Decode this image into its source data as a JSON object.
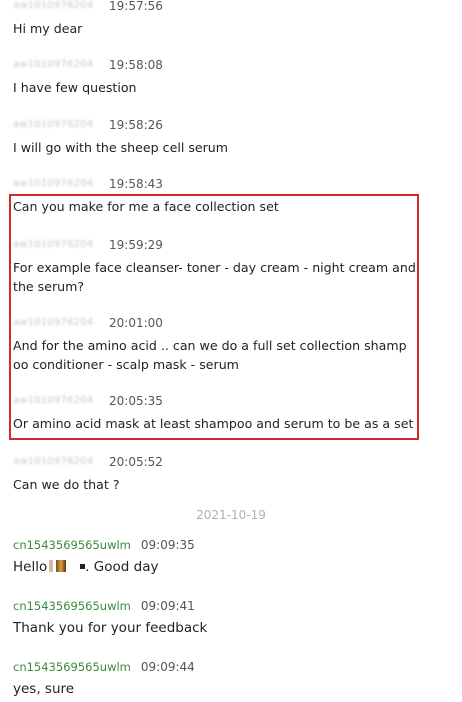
{
  "messages": [
    {
      "sender": "aw1010976204",
      "time": "19:57:56",
      "text": "Hi my dear"
    },
    {
      "sender": "aw1010976204",
      "time": "19:58:08",
      "text": "I have few question"
    },
    {
      "sender": "aw1010976204",
      "time": "19:58:26",
      "text": "I will go with the sheep cell serum"
    },
    {
      "sender": "aw1010976204",
      "time": "19:58:43",
      "text": "Can you make for me a face collection set"
    },
    {
      "sender": "aw1010976204",
      "time": "19:59:29",
      "text": "For example face cleanser- toner - day cream - night cream and the serum?"
    },
    {
      "sender": "aw1010976204",
      "time": "20:01:00",
      "text": "And for the amino acid .. can we do a full set collection shampoo conditioner - scalp mask - serum"
    },
    {
      "sender": "aw1010976204",
      "time": "20:05:35",
      "text": "Or amino acid mask at least shampoo and serum to be as a set"
    },
    {
      "sender": "aw1010976204",
      "time": "20:05:52",
      "text": "Can we do that ?"
    }
  ],
  "date_separator": "2021-10-19",
  "replies": [
    {
      "sender": "cn1543569565uwlm",
      "time": "09:09:35",
      "text_before": "Hello",
      "text_after": ". Good day"
    },
    {
      "sender": "cn1543569565uwlm",
      "time": "09:09:41",
      "text": "Thank you for your feedback"
    },
    {
      "sender": "cn1543569565uwlm",
      "time": "09:09:44",
      "text": "yes, sure"
    }
  ],
  "colors": {
    "highlight_border": "#d42a2a",
    "seller_name": "#3b8a3b",
    "time": "#555555",
    "date_separator": "#b0b0b0"
  }
}
